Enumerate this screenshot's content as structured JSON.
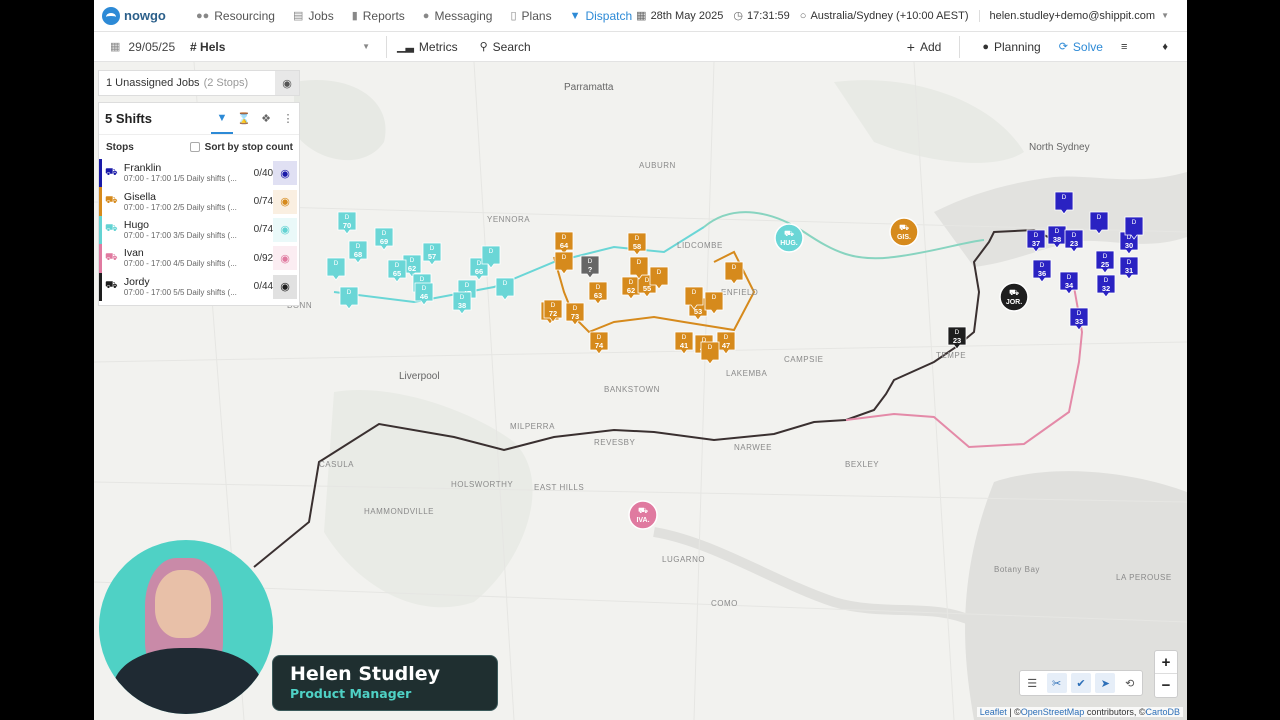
{
  "brand": {
    "name": "nowgo"
  },
  "nav": {
    "items": [
      {
        "label": "Resourcing",
        "icon": "users-icon"
      },
      {
        "label": "Jobs",
        "icon": "list-icon"
      },
      {
        "label": "Reports",
        "icon": "document-icon"
      },
      {
        "label": "Messaging",
        "icon": "chat-icon"
      },
      {
        "label": "Plans",
        "icon": "folder-icon"
      },
      {
        "label": "Dispatch",
        "icon": "pin-icon",
        "active": true
      }
    ],
    "date": "28th May 2025",
    "time": "17:31:59",
    "timezone": "Australia/Sydney (+10:00 AEST)",
    "user": "helen.studley+demo@shippit.com"
  },
  "toolbar": {
    "date_value": "29/05/25",
    "filter_value": "Hels",
    "metrics_label": "Metrics",
    "search_label": "Search",
    "add_label": "Add",
    "planning_label": "Planning",
    "solve_label": "Solve"
  },
  "unassigned": {
    "label": "1 Unassigned Jobs",
    "stops": "(2 Stops)"
  },
  "shifts_panel": {
    "title": "5 Shifts",
    "stops_label": "Stops",
    "sort_label": "Sort by stop count",
    "rows": [
      {
        "name": "Franklin",
        "detail": "07:00 - 17:00 1/5 Daily shifts (...",
        "count": "0/40",
        "color": "#1a1aa8"
      },
      {
        "name": "Gisella",
        "detail": "07:00 - 17:00 2/5 Daily shifts (...",
        "count": "0/74",
        "color": "#d68a1c"
      },
      {
        "name": "Hugo",
        "detail": "07:00 - 17:00 3/5 Daily shifts (...",
        "count": "0/74",
        "color": "#63d3d3"
      },
      {
        "name": "Ivan",
        "detail": "07:00 - 17:00 4/5 Daily shifts (...",
        "count": "0/92",
        "color": "#e07aa0"
      },
      {
        "name": "Jordy",
        "detail": "07:00 - 17:00 5/5 Daily shifts (...",
        "count": "0/44",
        "color": "#1e1e1e"
      }
    ]
  },
  "map": {
    "place_labels": [
      "Parramatta",
      "North Sydney",
      "Liverpool",
      "AUBURN",
      "YENNORA",
      "LIDCOMBE",
      "ENFIELD",
      "CAMPSIE",
      "BANKSTOWN",
      "LAKEMBA",
      "TEMPE",
      "MILPERRA",
      "REVESBY",
      "NARWEE",
      "BEXLEY",
      "CASULA",
      "HOLSWORTHY",
      "EAST HILLS",
      "COMO",
      "BONN",
      "Botany Bay",
      "LA PEROUSE",
      "HAMMONDVILLE",
      "LUGARNO",
      "TEMPE"
    ],
    "depot_labels": [
      "HUG.",
      "GIS.",
      "JOR.",
      "IVA."
    ],
    "franklin_stops": [
      "37",
      "38",
      "23",
      "30",
      "36",
      "34",
      "25",
      "31",
      "32",
      "33"
    ],
    "gisella_stops": [
      "64",
      "58",
      "71",
      "63",
      "62",
      "55",
      "72",
      "73",
      "74",
      "53",
      "41",
      "42",
      "47"
    ],
    "hugo_stops": [
      "70",
      "69",
      "68",
      "62",
      "57",
      "65",
      "48",
      "66",
      "47",
      "46",
      "38"
    ],
    "jordy_stops": [
      "23",
      "31"
    ],
    "unassigned_marker": "?",
    "stop_letter": "D"
  },
  "controls": {
    "zoom_in": "+",
    "zoom_out": "−"
  },
  "attribution": {
    "leaflet": "Leaflet",
    "sep": " | ©",
    "osm": "OpenStreetMap",
    "mid": " contributors, ©",
    "carto": "CartoDB"
  },
  "presenter": {
    "name": "Helen Studley",
    "role": "Product Manager"
  }
}
